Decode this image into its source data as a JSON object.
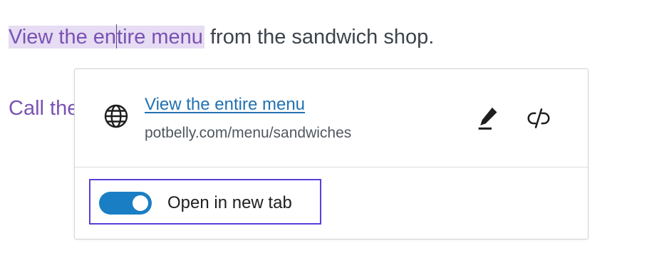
{
  "editor": {
    "paragraph1": {
      "link_part1": "View the en",
      "link_part2": "tire menu",
      "rest": " from the sandwich shop."
    },
    "paragraph2": {
      "text": "Call the"
    },
    "colors": {
      "link_text": "#7a52b3",
      "link_highlight": "#e6dcf3",
      "body_text": "#3c434a"
    }
  },
  "link_popover": {
    "title": "View the entire menu",
    "url": "potbelly.com/menu/sandwiches",
    "icons": {
      "site": "globe-icon",
      "edit": "pencil-icon",
      "unlink": "unlink-icon"
    },
    "settings": {
      "open_in_new_tab": {
        "label": "Open in new tab",
        "checked": true
      }
    },
    "colors": {
      "link": "#2271b1",
      "toggle_on": "#1a7ec4",
      "focus_outline": "#5b3fd9"
    }
  }
}
